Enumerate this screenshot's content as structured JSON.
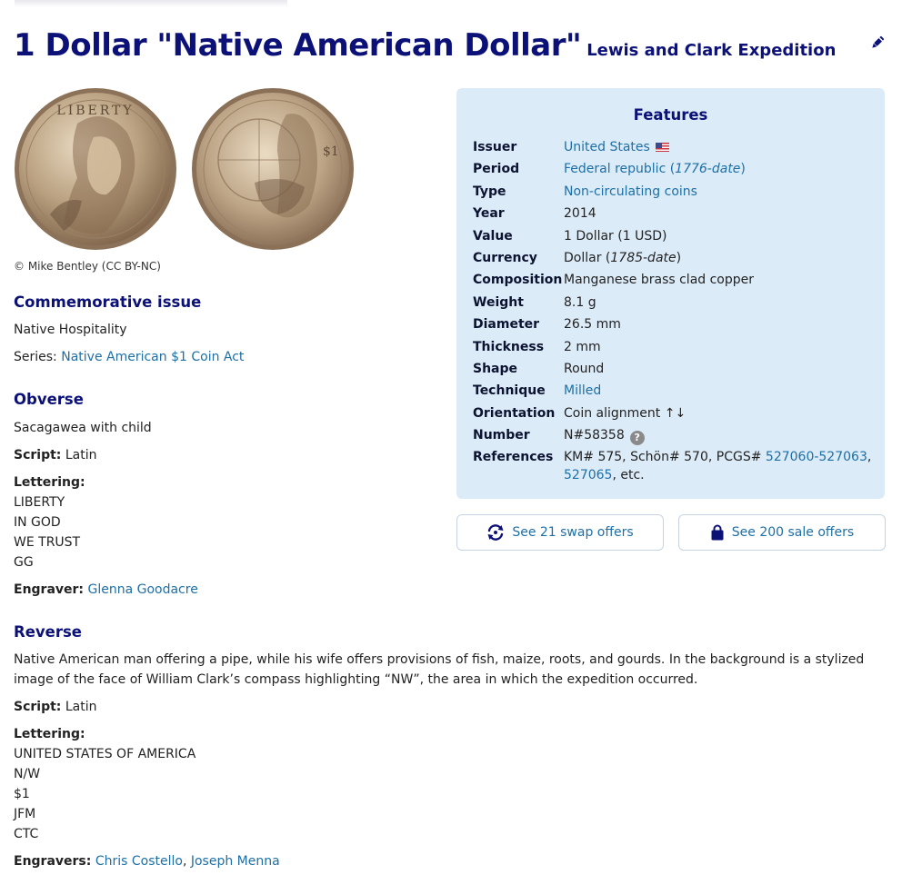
{
  "page": {
    "title": "1 Dollar \"Native American Dollar\"",
    "subtitle": "Lewis and Clark Expedition",
    "edit_icon": "pencil-icon",
    "image_credit": "© Mike Bentley (CC BY-NC)"
  },
  "commemorative": {
    "heading": "Commemorative issue",
    "name": "Native Hospitality",
    "series_label": "Series:",
    "series_value": "Native American $1 Coin Act"
  },
  "obverse": {
    "heading": "Obverse",
    "description": "Sacagawea with child",
    "script_label": "Script:",
    "script_value": "Latin",
    "lettering_label": "Lettering:",
    "lettering": [
      "LIBERTY",
      "IN GOD",
      "WE TRUST",
      "GG"
    ],
    "engraver_label": "Engraver:",
    "engraver": "Glenna Goodacre"
  },
  "reverse": {
    "heading": "Reverse",
    "description": "Native American man offering a pipe, while his wife offers provisions of fish, maize, roots, and gourds. In the background is a stylized image of the face of William Clark’s compass highlighting “NW”, the area in which the expedition occurred.",
    "script_label": "Script:",
    "script_value": "Latin",
    "lettering_label": "Lettering:",
    "lettering": [
      "UNITED STATES OF AMERICA",
      "N/W",
      "$1",
      "JFM",
      "CTC"
    ],
    "engravers_label": "Engravers:",
    "engraver_1": "Chris Costello",
    "engraver_sep": ", ",
    "engraver_2": "Joseph Menna"
  },
  "features": {
    "heading": "Features",
    "issuer_label": "Issuer",
    "issuer": "United States",
    "period_label": "Period",
    "period": "Federal republic (",
    "period_dates": "1776-date",
    "period_close": ")",
    "type_label": "Type",
    "type": "Non-circulating coins",
    "year_label": "Year",
    "year": "2014",
    "value_label": "Value",
    "value": "1 Dollar (1 USD)",
    "currency_label": "Currency",
    "currency": "Dollar (",
    "currency_dates": "1785-date",
    "currency_close": ")",
    "composition_label": "Composition",
    "composition": "Manganese brass clad copper",
    "weight_label": "Weight",
    "weight": "8.1 g",
    "diameter_label": "Diameter",
    "diameter": "26.5 mm",
    "thickness_label": "Thickness",
    "thickness": "2 mm",
    "shape_label": "Shape",
    "shape": "Round",
    "technique_label": "Technique",
    "technique": "Milled",
    "orientation_label": "Orientation",
    "orientation": "Coin alignment ↑↓",
    "number_label": "Number",
    "number": "N#58358",
    "references_label": "References",
    "references_text": "KM# 575, Schön# 570, PCGS# ",
    "references_link_1": "527060-527063",
    "references_sep": ",",
    "references_link_2": "527065",
    "references_end": ", etc."
  },
  "offers": {
    "swap_label": "See 21 swap offers",
    "sale_label": "See 200 sale offers"
  },
  "colors": {
    "heading": "#0c1178",
    "link": "#1d6fa5",
    "features_bg": "#dcebf8"
  }
}
